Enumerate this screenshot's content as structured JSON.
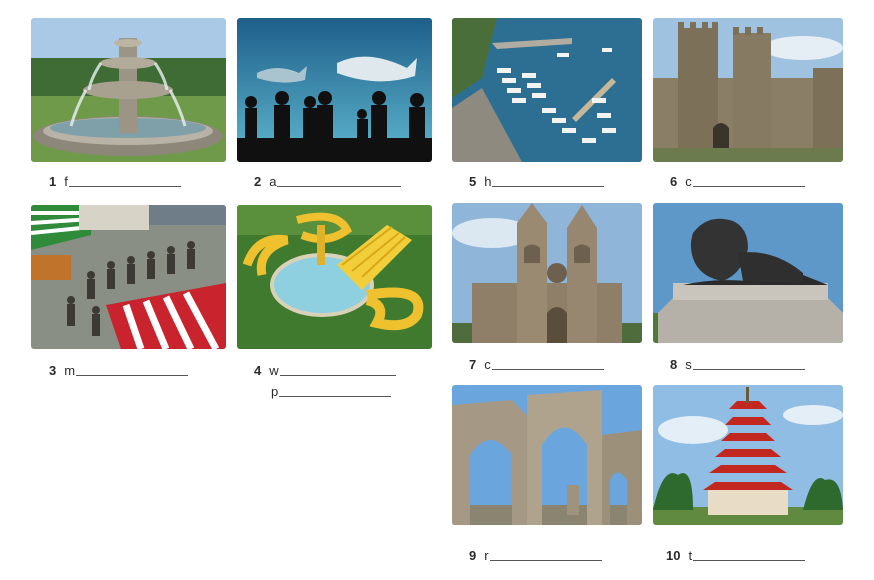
{
  "items": [
    {
      "number": "1",
      "letter": "f",
      "image": "fountain"
    },
    {
      "number": "2",
      "letter": "a",
      "image": "aquarium"
    },
    {
      "number": "3",
      "letter": "m",
      "image": "market"
    },
    {
      "number": "4",
      "letter": "w",
      "letter2": "p",
      "image": "water-park"
    },
    {
      "number": "5",
      "letter": "h",
      "image": "harbour"
    },
    {
      "number": "6",
      "letter": "c",
      "image": "castle"
    },
    {
      "number": "7",
      "letter": "c",
      "image": "cathedral"
    },
    {
      "number": "8",
      "letter": "s",
      "image": "statue"
    },
    {
      "number": "9",
      "letter": "r",
      "image": "ruins"
    },
    {
      "number": "10",
      "letter": "t",
      "image": "temple"
    }
  ]
}
